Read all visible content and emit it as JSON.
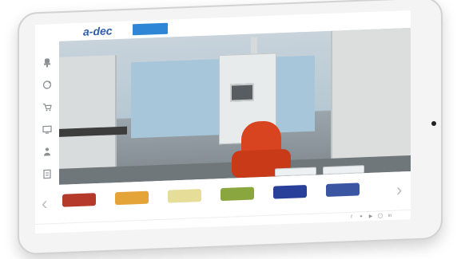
{
  "app": {
    "logo_text": "a-dec"
  },
  "nav": {
    "tabs": [
      {
        "label": "",
        "active": true
      },
      {
        "label": "",
        "active": false
      },
      {
        "label": "",
        "active": false
      },
      {
        "label": "",
        "active": false
      },
      {
        "label": "",
        "active": false
      },
      {
        "label": "",
        "active": false
      }
    ]
  },
  "toolbar": {
    "tools": [
      {
        "icon": "chair-icon"
      },
      {
        "icon": "rotate-icon"
      },
      {
        "icon": "cart-icon"
      },
      {
        "icon": "monitor-icon"
      },
      {
        "icon": "person-icon"
      },
      {
        "icon": "document-icon"
      }
    ]
  },
  "scene": {
    "buttons": [
      {
        "label": ""
      },
      {
        "label": ""
      }
    ],
    "chair_color": "#d8441f"
  },
  "swatches": {
    "items": [
      {
        "color": "#b63a2a",
        "label": ""
      },
      {
        "color": "#e5a437",
        "label": ""
      },
      {
        "color": "#e6dd98",
        "label": ""
      },
      {
        "color": "#8aa63f",
        "label": ""
      },
      {
        "color": "#28409a",
        "label": ""
      },
      {
        "color": "#3a55a2",
        "label": ""
      }
    ]
  },
  "footer": {
    "text": "",
    "social_icons": [
      "facebook-icon",
      "twitter-icon",
      "youtube-icon",
      "instagram-icon",
      "linkedin-icon"
    ]
  }
}
